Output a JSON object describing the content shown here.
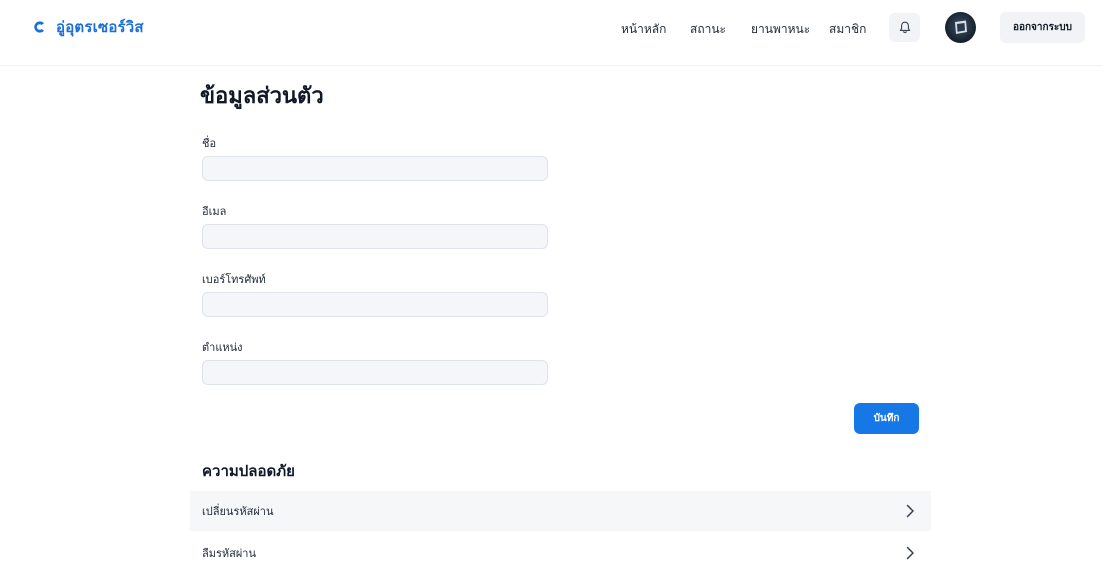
{
  "header": {
    "brand_name": "อู่อุตรเซอร์วิส",
    "nav": [
      {
        "label": "หน้าหลัก"
      },
      {
        "label": "สถานะ"
      },
      {
        "label": "ยานพาหนะ"
      },
      {
        "label": "สมาชิก"
      }
    ],
    "logout_label": "ออกจากระบบ",
    "icons": {
      "bell": "bell-icon",
      "brand": "brand-logo-icon",
      "avatar": "avatar"
    }
  },
  "profile": {
    "title": "ข้อมูลส่วนตัว",
    "fields": [
      {
        "label": "ชื่อ",
        "value": "",
        "placeholder": ""
      },
      {
        "label": "อีเมล",
        "value": "",
        "placeholder": ""
      },
      {
        "label": "เบอร์โทรศัพท์",
        "value": "",
        "placeholder": ""
      },
      {
        "label": "ตำแหน่ง",
        "value": "",
        "placeholder": ""
      }
    ],
    "save_label": "บันทึก"
  },
  "security": {
    "title": "ความปลอดภัย",
    "items": [
      {
        "label": "เปลี่ยนรหัสผ่าน"
      },
      {
        "label": "ลืมรหัสผ่าน"
      }
    ]
  },
  "colors": {
    "accent": "#1677e6",
    "brand": "#1d6fd8",
    "input_bg": "#f4f6f9",
    "row_bg": "#f6f7f9"
  }
}
